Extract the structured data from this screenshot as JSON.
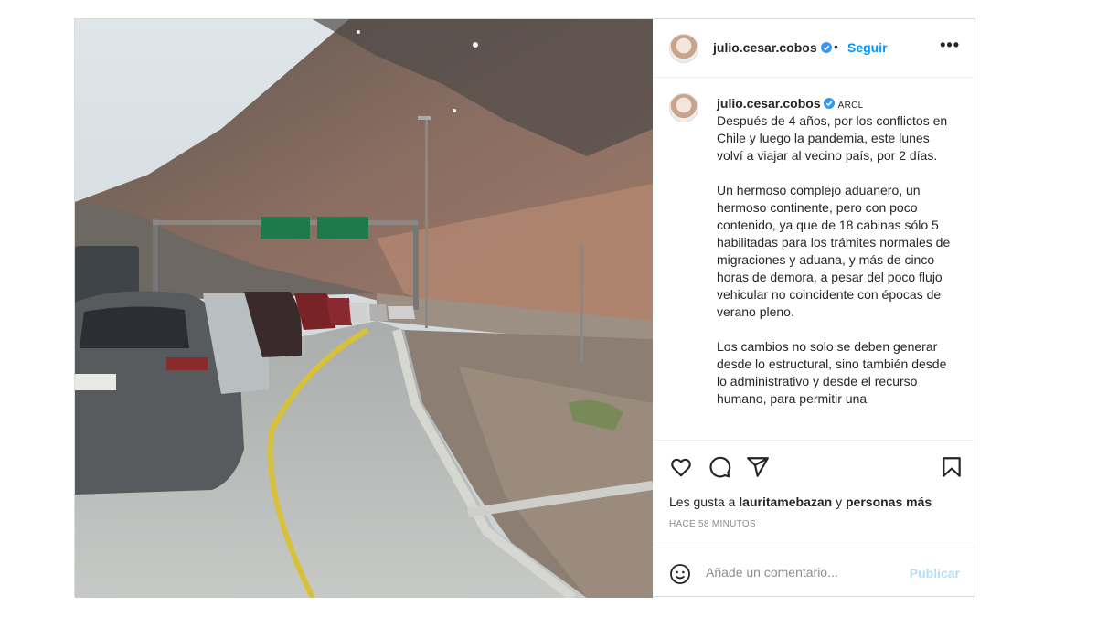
{
  "post": {
    "username": "julio.cesar.cobos",
    "separator": "•",
    "follow_label": "Seguir",
    "more_label": "•••",
    "caption": {
      "username": "julio.cesar.cobos",
      "location_tag": "ARCL",
      "paragraphs": [
        "Después de 4 años, por los conflictos en Chile y luego la pandemia, este lunes volví a viajar al vecino país, por 2 días.",
        "Un hermoso complejo aduanero, un hermoso continente, pero con poco contenido, ya que de 18 cabinas sólo 5 habilitadas para los trámites normales de migraciones y aduana, y más de cinco horas de demora, a pesar del poco flujo vehicular no coincidente con épocas de verano pleno.",
        "Los cambios no solo se deben generar desde lo estructural, sino también desde lo administrativo y desde el recurso humano, para permitir una"
      ]
    },
    "likes": {
      "prefix": "Les gusta a",
      "user": "lauritamebazan",
      "connector": "y",
      "rest": "personas más"
    },
    "timestamp": "HACE 58 MINUTOS",
    "comment": {
      "placeholder": "Añade un comentario...",
      "publish_label": "Publicar"
    },
    "icons": {
      "like": "heart-icon",
      "comment": "comment-icon",
      "share": "send-icon",
      "save": "bookmark-icon",
      "emoji": "emoji-icon",
      "verified": "verified-badge-icon"
    },
    "colors": {
      "accent": "#0095f6",
      "verified": "#3897f0",
      "publish_disabled": "#b2dffc",
      "muted": "#8e8e8e"
    }
  }
}
